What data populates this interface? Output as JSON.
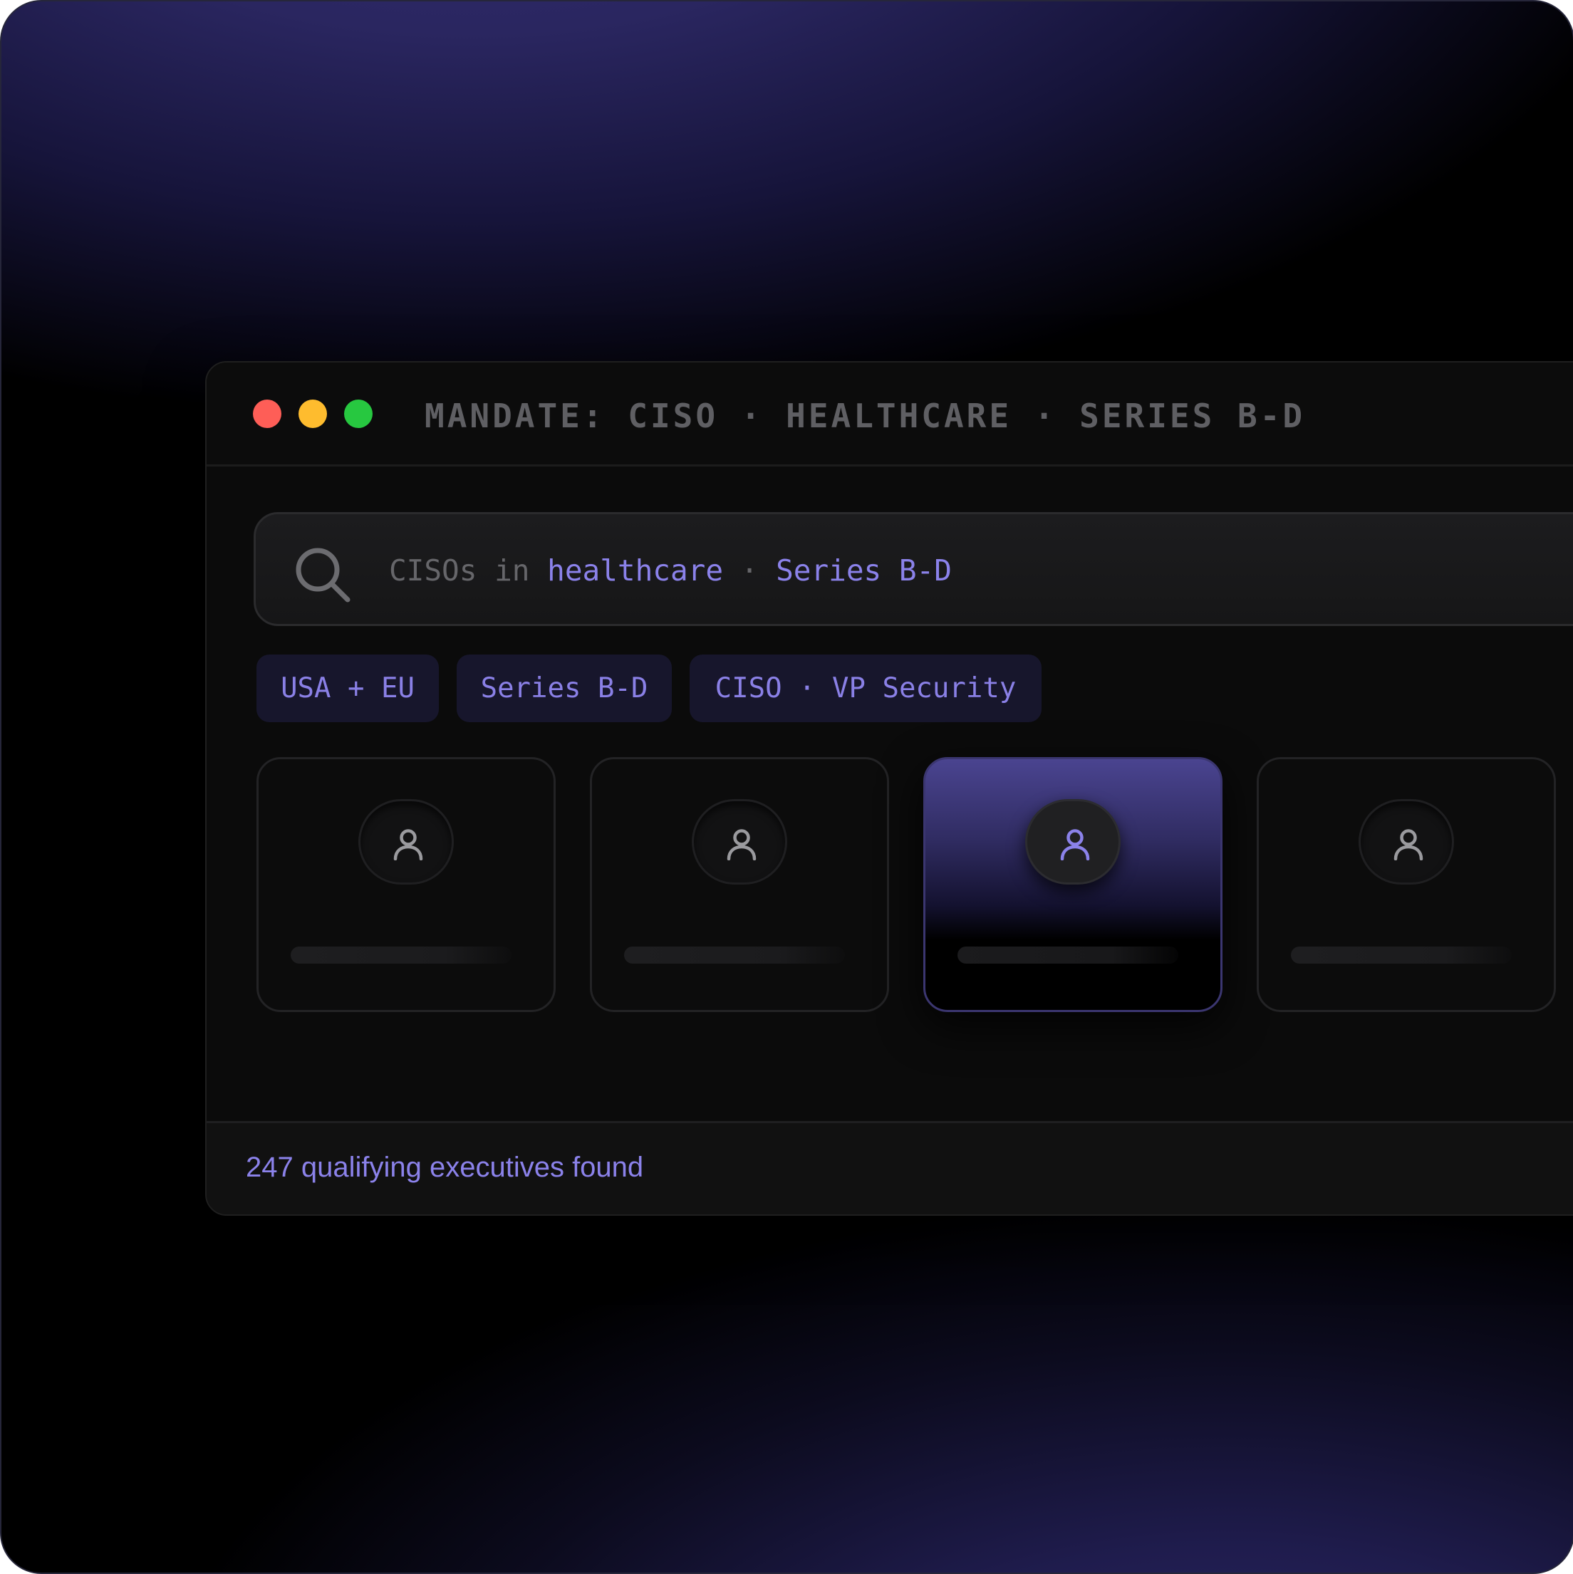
{
  "window": {
    "mandate_title": "MANDATE: CISO · HEALTHCARE · SERIES B-D"
  },
  "search": {
    "query_dim_1": "CISOs in ",
    "query_accent_1": "healthcare",
    "query_dim_2": " · ",
    "query_accent_2": "Series B-D"
  },
  "chips": [
    {
      "label": "USA + EU"
    },
    {
      "label": "Series B-D"
    },
    {
      "label": "CISO · VP Security"
    }
  ],
  "cards": [
    {
      "icon": "user-icon",
      "selected": false
    },
    {
      "icon": "user-icon",
      "selected": false
    },
    {
      "icon": "user-icon",
      "selected": true
    },
    {
      "icon": "user-icon",
      "selected": false
    }
  ],
  "footer": {
    "result_text": "247 qualifying executives found"
  },
  "colors": {
    "accent": "#8b82ea",
    "traffic_red": "#fe5e57",
    "traffic_yellow": "#febc2e",
    "traffic_green": "#27c840"
  }
}
